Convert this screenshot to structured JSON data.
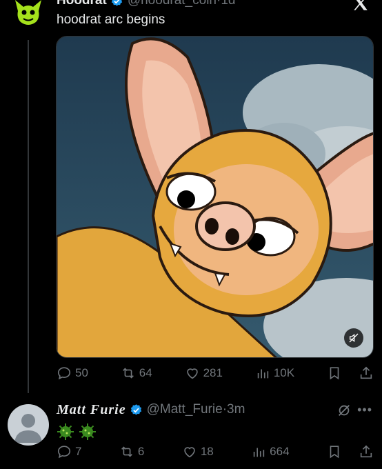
{
  "tweet1": {
    "name": "Hoodrat",
    "handle": "@hoodrat_coin",
    "separator": " · ",
    "time": "1d",
    "text": "hoodrat arc begins",
    "stats": {
      "replies": "50",
      "reposts": "64",
      "likes": "281",
      "views": "10K"
    }
  },
  "tweet2": {
    "name": "Matt Furie",
    "handle": "@Matt_Furie",
    "separator": " · ",
    "time": "3m",
    "emoji": [
      "coronavirus-emoji",
      "coronavirus-emoji"
    ],
    "stats": {
      "replies": "7",
      "reposts": "6",
      "likes": "18",
      "views": "664"
    }
  },
  "colors": {
    "background": "#000000",
    "text": "#e7e9ea",
    "muted": "#71767b",
    "verified": "#1d9bf0",
    "avatar_green": "#a4e11c"
  }
}
